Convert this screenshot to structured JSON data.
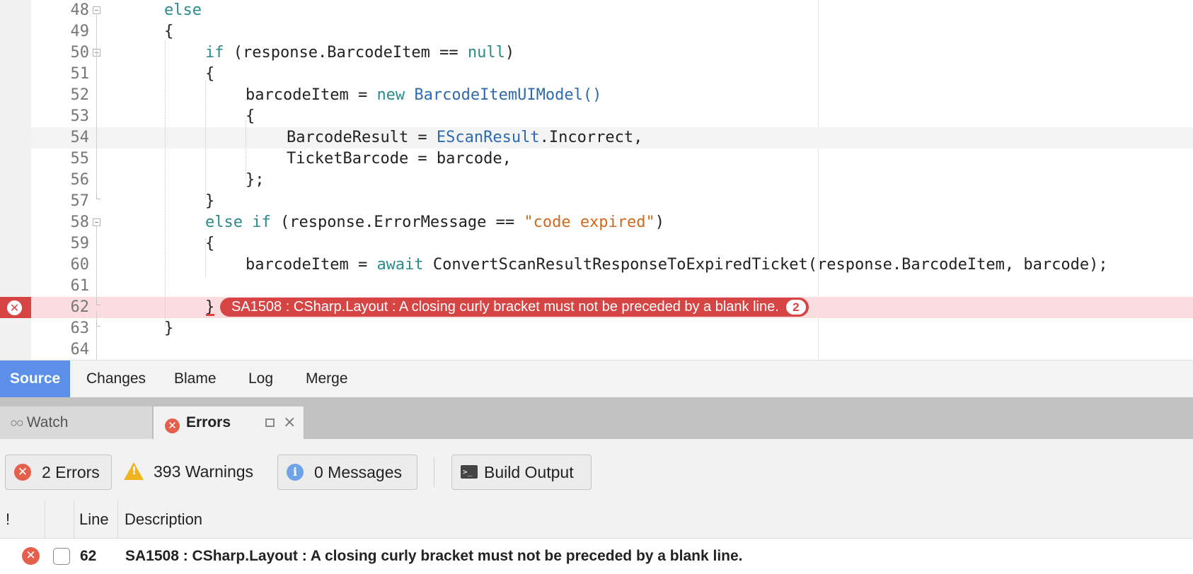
{
  "editor": {
    "lines": [
      {
        "num": "48"
      },
      {
        "num": "49"
      },
      {
        "num": "50"
      },
      {
        "num": "51"
      },
      {
        "num": "52"
      },
      {
        "num": "53"
      },
      {
        "num": "54"
      },
      {
        "num": "55"
      },
      {
        "num": "56"
      },
      {
        "num": "57"
      },
      {
        "num": "58"
      },
      {
        "num": "59"
      },
      {
        "num": "60"
      },
      {
        "num": "61"
      },
      {
        "num": "62"
      },
      {
        "num": "63"
      },
      {
        "num": "64"
      }
    ],
    "code": {
      "l48": "else",
      "l49": "{",
      "l50_kw": "if",
      "l50_a": " (response.BarcodeItem == ",
      "l50_null": "null",
      "l50_b": ")",
      "l51": "{",
      "l52_a": "barcodeItem = ",
      "l52_new": "new",
      "l52_type": " BarcodeItemUIModel()",
      "l53": "{",
      "l54_a": "BarcodeResult = ",
      "l54_type": "EScanResult",
      "l54_b": ".Incorrect,",
      "l55": "TicketBarcode = barcode,",
      "l56": "};",
      "l57": "}",
      "l58_kw": "else if",
      "l58_a": " (response.ErrorMessage == ",
      "l58_str": "\"code expired\"",
      "l58_b": ")",
      "l59": "{",
      "l60_a": "barcodeItem = ",
      "l60_await": "await",
      "l60_b": " ConvertScanResultResponseToExpiredTicket(response.BarcodeItem, barcode);",
      "l62": "}",
      "l63": "}"
    },
    "inline_error": {
      "message": "SA1508 : CSharp.Layout : A closing curly bracket must not be preceded by a blank line.",
      "count": "2"
    }
  },
  "editor_tabs": [
    "Source",
    "Changes",
    "Blame",
    "Log",
    "Merge"
  ],
  "pad_tabs": {
    "watch": "Watch",
    "errors": "Errors"
  },
  "toolbar": {
    "errors": "2 Errors",
    "warnings": "393 Warnings",
    "messages": "0 Messages",
    "build_output": "Build Output"
  },
  "list": {
    "headers": {
      "severity": "!",
      "line": "Line",
      "description": "Description"
    },
    "rows": [
      {
        "line": "62",
        "description": "SA1508 : CSharp.Layout : A closing curly bracket must not be preceded by a blank line."
      }
    ]
  },
  "colors": {
    "error": "#d64444",
    "active_tab": "#5b8fe8",
    "keyword": "#2b8a8a",
    "type": "#2e6ab0",
    "string": "#d2691e"
  }
}
